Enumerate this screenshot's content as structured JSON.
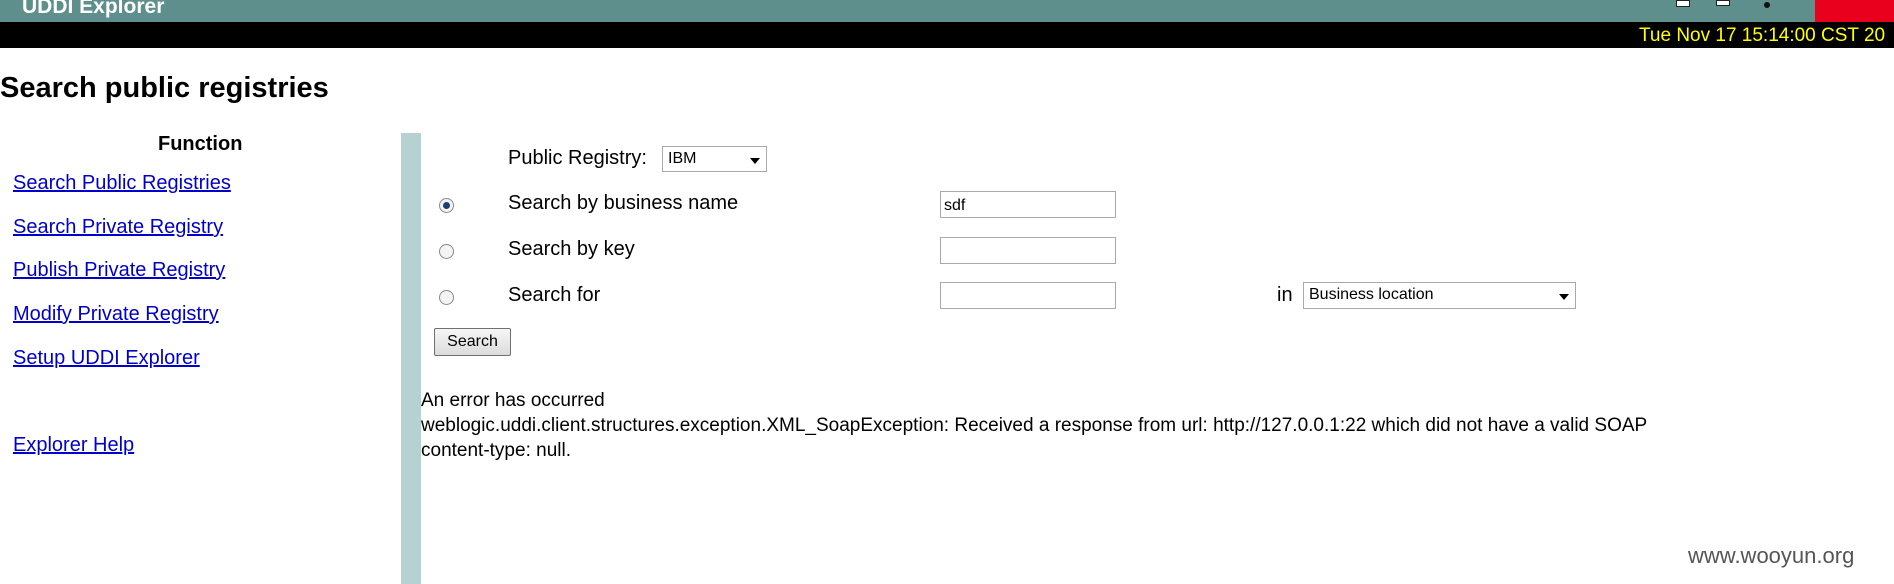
{
  "app": {
    "title": "UDDI Explorer",
    "datetime": "Tue Nov 17 15:14:00 CST 20"
  },
  "page_title": "Search public registries",
  "nav": {
    "heading": "Function",
    "items": [
      "Search Public Registries",
      "Search Private Registry",
      "Publish Private Registry",
      "Modify Private Registry",
      "Setup UDDI Explorer"
    ],
    "help": "Explorer Help"
  },
  "form": {
    "registry_label": "Public Registry:",
    "registry_value": "IBM",
    "option_business_name": "Search by business name",
    "business_name_value": "sdf",
    "option_key": "Search by key",
    "key_value": "",
    "option_search_for": "Search for",
    "search_for_value": "",
    "in_label": "in",
    "in_value": "Business location",
    "selected_option": "business_name",
    "search_button": "Search"
  },
  "error": {
    "title": "An error has occurred",
    "line1": "weblogic.uddi.client.structures.exception.XML_SoapException: Received a response from url: http://127.0.0.1:22 which did not have a valid SOAP",
    "line2": "content-type: null."
  },
  "watermark": "www.wooyun.org",
  "colors": {
    "header_bg": "#5f8f8c",
    "datetime_fg": "#ffff00",
    "link": "#0000cc",
    "separator": "#b7d0d0"
  }
}
